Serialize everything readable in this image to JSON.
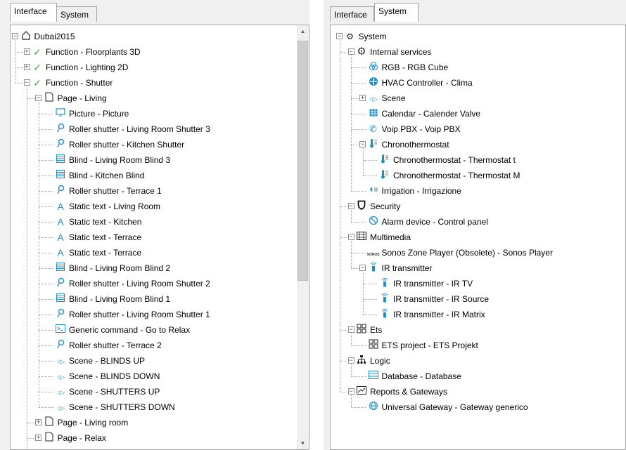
{
  "left_panel": {
    "tabs": [
      {
        "label": "Interface",
        "active": true
      },
      {
        "label": "System",
        "active": false
      }
    ],
    "tree": [
      {
        "label": "Dubai2015",
        "icon": "home-icon",
        "level": 0,
        "expander": "minus"
      },
      {
        "label": "Function - Floorplants 3D",
        "icon": "check-icon",
        "level": 1,
        "expander": "plus"
      },
      {
        "label": "Function - Lighting 2D",
        "icon": "check-icon",
        "level": 1,
        "expander": "plus"
      },
      {
        "label": "Function - Shutter",
        "icon": "check-icon",
        "level": 1,
        "expander": "minus"
      },
      {
        "label": "Page - Living",
        "icon": "page-icon",
        "level": 2,
        "expander": "minus"
      },
      {
        "label": "Picture - Picture",
        "icon": "picture-icon",
        "level": 3
      },
      {
        "label": "Roller shutter - Living Room Shutter 3",
        "icon": "roller-shutter-icon",
        "level": 3
      },
      {
        "label": "Roller shutter - Kitchen Shutter",
        "icon": "roller-shutter-icon",
        "level": 3
      },
      {
        "label": "Blind - Living Room Blind 3",
        "icon": "blind-icon",
        "level": 3
      },
      {
        "label": "Blind - Kitchen Blind",
        "icon": "blind-icon",
        "level": 3
      },
      {
        "label": "Roller shutter - Terrace 1",
        "icon": "roller-shutter-icon",
        "level": 3
      },
      {
        "label": "Static text - Living Room",
        "icon": "static-text-icon",
        "level": 3
      },
      {
        "label": "Static text - Kitchen",
        "icon": "static-text-icon",
        "level": 3
      },
      {
        "label": "Static text - Terrace",
        "icon": "static-text-icon",
        "level": 3
      },
      {
        "label": "Static text - Terrace",
        "icon": "static-text-icon",
        "level": 3
      },
      {
        "label": "Blind - Living Room Blind 2",
        "icon": "blind-icon",
        "level": 3
      },
      {
        "label": "Roller shutter - Living Room Shutter 2",
        "icon": "roller-shutter-icon",
        "level": 3
      },
      {
        "label": "Blind - Living Room Blind 1",
        "icon": "blind-icon",
        "level": 3
      },
      {
        "label": "Roller shutter - Living Room Shutter 1",
        "icon": "roller-shutter-icon",
        "level": 3
      },
      {
        "label": "Generic command - Go to Relax",
        "icon": "command-icon",
        "level": 3
      },
      {
        "label": "Roller shutter - Terrace 2",
        "icon": "roller-shutter-icon",
        "level": 3
      },
      {
        "label": "Scene - BLINDS UP",
        "icon": "scene-icon",
        "level": 3
      },
      {
        "label": "Scene - BLINDS DOWN",
        "icon": "scene-icon",
        "level": 3
      },
      {
        "label": "Scene - SHUTTERS UP",
        "icon": "scene-icon",
        "level": 3
      },
      {
        "label": "Scene - SHUTTERS DOWN",
        "icon": "scene-icon",
        "level": 3
      },
      {
        "label": "Page - Living room",
        "icon": "page-icon",
        "level": 2,
        "expander": "plus"
      },
      {
        "label": "Page - Relax",
        "icon": "page-icon",
        "level": 2,
        "expander": "plus"
      }
    ]
  },
  "right_panel": {
    "tabs": [
      {
        "label": "Interface",
        "active": false
      },
      {
        "label": "System",
        "active": true
      }
    ],
    "tree": [
      {
        "label": "System",
        "icon": "system-gears-icon",
        "level": 0,
        "expander": "minus"
      },
      {
        "label": "Internal services",
        "icon": "gear-icon",
        "level": 1,
        "expander": "minus"
      },
      {
        "label": "RGB - RGB Cube",
        "icon": "rgb-icon",
        "level": 2
      },
      {
        "label": "HVAC Controller - Clima",
        "icon": "hvac-icon",
        "level": 2
      },
      {
        "label": "Scene",
        "icon": "scene-icon",
        "level": 2,
        "expander": "plus"
      },
      {
        "label": "Calendar - Calender Valve",
        "icon": "calendar-icon",
        "level": 2
      },
      {
        "label": "Voip PBX - Voip PBX",
        "icon": "phone-icon",
        "level": 2
      },
      {
        "label": "Chronothermostat",
        "icon": "thermometer-icon",
        "level": 2,
        "expander": "minus"
      },
      {
        "label": "Chronothermostat - Thermostat t",
        "icon": "thermometer-icon",
        "level": 3
      },
      {
        "label": "Chronothermostat - Thermostat M",
        "icon": "thermometer-icon",
        "level": 3
      },
      {
        "label": "Irrigation - Irrigazione",
        "icon": "irrigation-icon",
        "level": 2
      },
      {
        "label": "Security",
        "icon": "shield-icon",
        "level": 1,
        "expander": "minus"
      },
      {
        "label": "Alarm device - Control panel",
        "icon": "alarm-icon",
        "level": 2
      },
      {
        "label": "Multimedia",
        "icon": "multimedia-icon",
        "level": 1,
        "expander": "minus"
      },
      {
        "label": "Sonos Zone Player (Obsolete) - Sonos Player",
        "icon": "sonos-icon",
        "level": 2
      },
      {
        "label": "IR transmitter",
        "icon": "ir-transmitter-icon",
        "level": 2,
        "expander": "minus"
      },
      {
        "label": "IR transmitter - IR TV",
        "icon": "ir-transmitter-icon",
        "level": 3
      },
      {
        "label": "IR transmitter - IR Source",
        "icon": "ir-transmitter-icon",
        "level": 3
      },
      {
        "label": "IR transmitter - IR Matrix",
        "icon": "ir-transmitter-icon",
        "level": 3
      },
      {
        "label": "Ets",
        "icon": "ets-icon",
        "level": 1,
        "expander": "minus"
      },
      {
        "label": "ETS project - ETS Projekt",
        "icon": "ets-icon",
        "level": 2
      },
      {
        "label": "Logic",
        "icon": "logic-icon",
        "level": 1,
        "expander": "minus"
      },
      {
        "label": "Database - Database",
        "icon": "database-icon",
        "level": 2
      },
      {
        "label": "Reports & Gateways",
        "icon": "reports-icon",
        "level": 1,
        "expander": "minus"
      },
      {
        "label": "Universal Gateway - Gateway generico",
        "icon": "gateway-icon",
        "level": 2
      }
    ]
  },
  "colors": {
    "icon_blue": "#1e90c8",
    "check_green": "#4aa24a",
    "border": "#a5a5a5",
    "scroll_thumb": "#cdcdcd"
  }
}
